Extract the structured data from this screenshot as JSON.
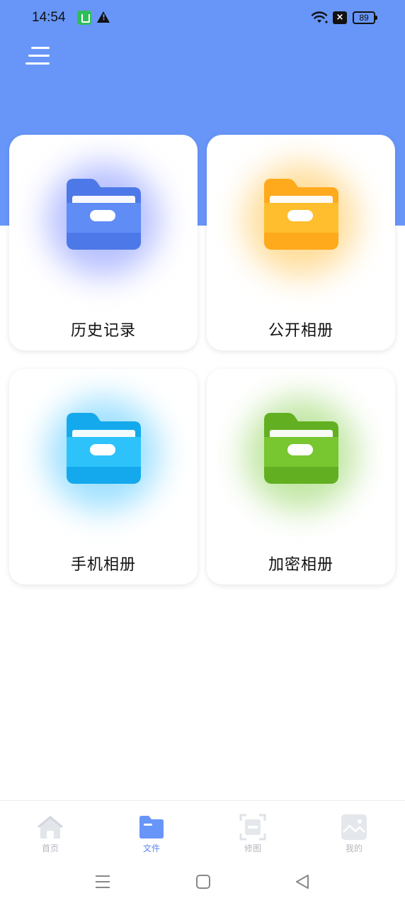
{
  "status_bar": {
    "time": "14:54",
    "battery": "89",
    "icons": [
      "app-notification-icon",
      "warning-icon",
      "wifi-icon",
      "no-sim-icon",
      "battery-icon"
    ]
  },
  "header": {
    "menu_icon": "menu-icon",
    "background_color": "#6896f8"
  },
  "folders": [
    {
      "label": "历史记录",
      "icon": "folder-icon",
      "color": "#5f8cf5",
      "color_dark": "#4d78e8",
      "glow": "#7b8cff"
    },
    {
      "label": "公开相册",
      "icon": "folder-icon",
      "color": "#ffbe2e",
      "color_dark": "#ffa91c",
      "glow": "#ffc24a"
    },
    {
      "label": "手机相册",
      "icon": "folder-icon",
      "color": "#2ec2fb",
      "color_dark": "#14a9ec",
      "glow": "#52c8ff"
    },
    {
      "label": "加密相册",
      "icon": "folder-icon",
      "color": "#78c630",
      "color_dark": "#62b022",
      "glow": "#8fd35a"
    }
  ],
  "tabbar": {
    "tabs": [
      {
        "label": "首页",
        "icon": "home-icon",
        "active": false
      },
      {
        "label": "文件",
        "icon": "folder-icon",
        "active": true
      },
      {
        "label": "修图",
        "icon": "scan-edit-icon",
        "active": false
      },
      {
        "label": "我的",
        "icon": "image-icon",
        "active": false
      }
    ],
    "active_color": "#5b87f4",
    "inactive_color": "#b3b7bf"
  },
  "system_nav": {
    "buttons": [
      "recents-button",
      "home-button",
      "back-button"
    ]
  }
}
